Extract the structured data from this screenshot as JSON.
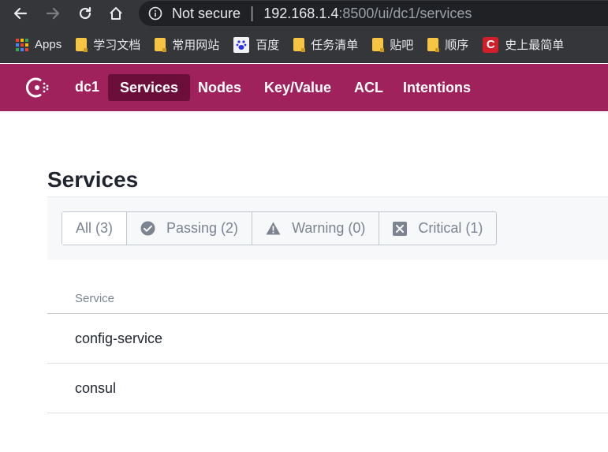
{
  "browser": {
    "security_label": "Not secure",
    "url_host": "192.168.1.4",
    "url_rest": ":8500/ui/dc1/services"
  },
  "bookmarks": [
    {
      "label": "Apps",
      "icon": "apps-grid-icon"
    },
    {
      "label": "学习文档",
      "icon": "folder-icon"
    },
    {
      "label": "常用网站",
      "icon": "folder-icon"
    },
    {
      "label": "百度",
      "icon": "baidu-icon"
    },
    {
      "label": "任务清单",
      "icon": "folder-icon"
    },
    {
      "label": "贴吧",
      "icon": "folder-icon"
    },
    {
      "label": "顺序",
      "icon": "folder-icon"
    },
    {
      "label": "史上最简单",
      "icon": "c-red-icon"
    }
  ],
  "nav": {
    "datacenter": "dc1",
    "items": [
      {
        "label": "Services",
        "active": true
      },
      {
        "label": "Nodes"
      },
      {
        "label": "Key/Value"
      },
      {
        "label": "ACL"
      },
      {
        "label": "Intentions"
      }
    ]
  },
  "page": {
    "title": "Services"
  },
  "filters": [
    {
      "label": "All (3)",
      "icon": "",
      "active": true
    },
    {
      "label": "Passing (2)",
      "icon": "check-circle-icon"
    },
    {
      "label": "Warning (0)",
      "icon": "warning-triangle-icon"
    },
    {
      "label": "Critical (1)",
      "icon": "x-square-icon"
    }
  ],
  "table": {
    "header": "Service",
    "rows": [
      "config-service",
      "consul"
    ]
  },
  "colors": {
    "brand": "#a0225d",
    "brand_active": "#6b0e3a",
    "chrome_dark": "#35363a",
    "omnibox": "#202124"
  }
}
